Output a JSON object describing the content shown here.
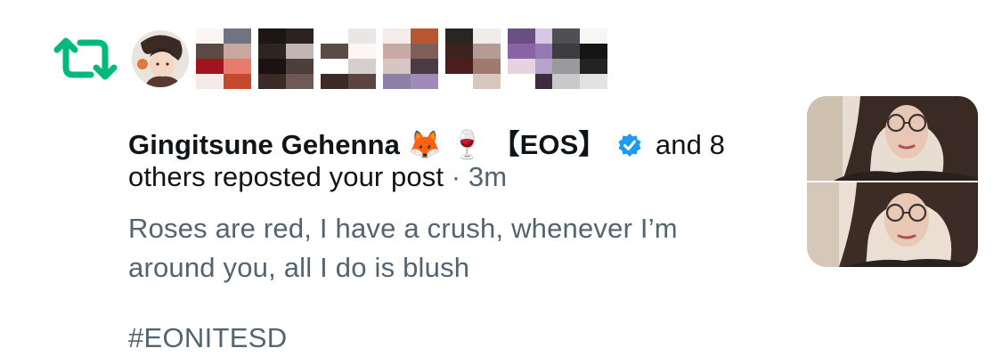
{
  "notification": {
    "icon": "repost-icon",
    "accent_color": "#00ba7c",
    "avatars": [
      {
        "name": "avatar-1",
        "style": "illustrated"
      },
      {
        "name": "avatar-2",
        "style": "pixelated"
      },
      {
        "name": "avatar-3",
        "style": "pixelated"
      },
      {
        "name": "avatar-4",
        "style": "pixelated"
      },
      {
        "name": "avatar-5",
        "style": "pixelated"
      },
      {
        "name": "avatar-6",
        "style": "pixelated"
      },
      {
        "name": "avatar-7",
        "style": "pixelated"
      },
      {
        "name": "avatar-8",
        "style": "pixelated"
      },
      {
        "name": "avatar-9",
        "style": "pixelated"
      }
    ],
    "actor_name": "Gingitsune Gehenna",
    "actor_emoji": "🦊 🍷",
    "actor_tag": "【EOS】",
    "verified_icon": "verified-badge-icon",
    "verified_color": "#1d9bf0",
    "others_part1": "and 8",
    "others_part2": "others reposted your post",
    "separator": "·",
    "time": "3m"
  },
  "post": {
    "text": "Roses are red, I have a crush, whenever I’m around you, all I do is blush",
    "hashtag": "#EONITESD",
    "text_color": "#536471"
  }
}
